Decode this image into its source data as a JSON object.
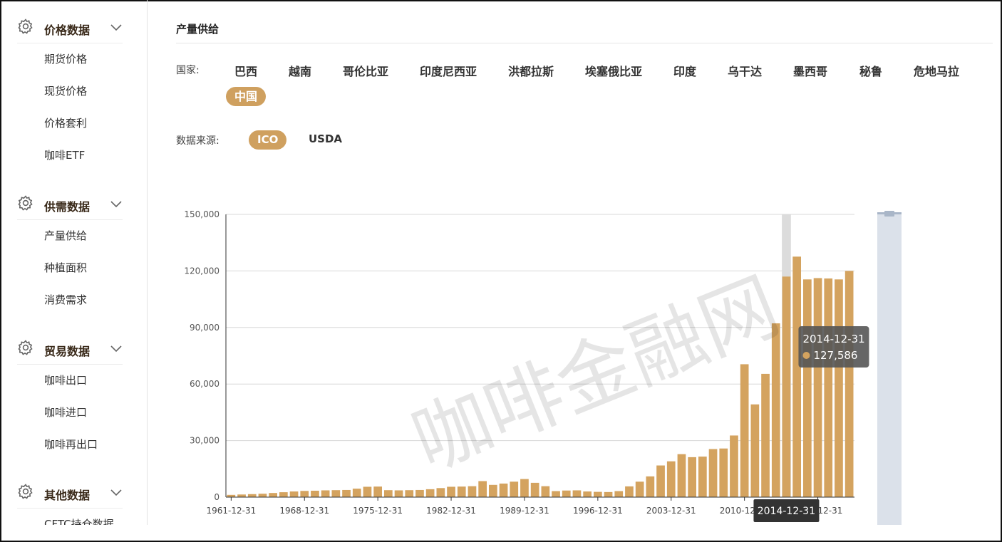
{
  "sidebar": {
    "groups": [
      {
        "title": "价格数据",
        "items": [
          "期货价格",
          "现货价格",
          "价格套利",
          "咖啡ETF"
        ]
      },
      {
        "title": "供需数据",
        "items": [
          "产量供给",
          "种植面积",
          "消费需求"
        ]
      },
      {
        "title": "贸易数据",
        "items": [
          "咖啡出口",
          "咖啡进口",
          "咖啡再出口"
        ]
      },
      {
        "title": "其他数据",
        "items": [
          "CFTC持仓数据"
        ]
      }
    ]
  },
  "main": {
    "title": "产量供给",
    "country_label": "国家:",
    "countries": [
      "巴西",
      "越南",
      "哥伦比亚",
      "印度尼西亚",
      "洪都拉斯",
      "埃塞俄比亚",
      "印度",
      "乌干达",
      "墨西哥",
      "秘鲁",
      "危地马拉",
      "中国"
    ],
    "selected_country": "中国",
    "source_label": "数据来源:",
    "sources": [
      "ICO",
      "USDA"
    ],
    "selected_source": "ICO"
  },
  "watermark": "咖啡金融网",
  "colors": {
    "bar": "#d4a35f",
    "accent": "#cfa05f",
    "highlight_column": "#dcdcdc",
    "tooltip_bg": "#555555",
    "axis_pointer_label": "#333333",
    "zoom_bar": "#dbe1ea"
  },
  "chart_data": {
    "type": "bar",
    "x_tick_labels": [
      "1961-12-31",
      "1968-12-31",
      "1975-12-31",
      "1982-12-31",
      "1989-12-31",
      "1996-12-31",
      "2003-12-31",
      "2010-12-31",
      "2017-12-31"
    ],
    "y_tick_labels": [
      "0",
      "30,000",
      "60,000",
      "90,000",
      "120,000",
      "150,000"
    ],
    "ylim": [
      0,
      150000
    ],
    "grid": true,
    "years": [
      1961,
      1962,
      1963,
      1964,
      1965,
      1966,
      1967,
      1968,
      1969,
      1970,
      1971,
      1972,
      1973,
      1974,
      1975,
      1976,
      1977,
      1978,
      1979,
      1980,
      1981,
      1982,
      1983,
      1984,
      1985,
      1986,
      1987,
      1988,
      1989,
      1990,
      1991,
      1992,
      1993,
      1994,
      1995,
      1996,
      1997,
      1998,
      1999,
      2000,
      2001,
      2002,
      2003,
      2004,
      2005,
      2006,
      2007,
      2008,
      2009,
      2010,
      2011,
      2012,
      2013,
      2014,
      2015,
      2016,
      2017,
      2018,
      2019
    ],
    "values": [
      1200,
      1400,
      1600,
      1800,
      2200,
      2600,
      3000,
      3300,
      3400,
      3600,
      3700,
      3800,
      4500,
      5500,
      5600,
      3700,
      3600,
      3700,
      3800,
      4200,
      4800,
      5500,
      5600,
      5800,
      8500,
      6500,
      7200,
      8200,
      9600,
      7600,
      5800,
      3200,
      3500,
      3600,
      3000,
      2800,
      2700,
      3200,
      5700,
      8200,
      11000,
      16800,
      19000,
      22800,
      21200,
      21500,
      25500,
      25800,
      32700,
      70500,
      49200,
      65400,
      92200,
      117000,
      127586,
      115500,
      116200,
      116000,
      115500,
      120000
    ],
    "tooltip": {
      "date": "2014-12-31",
      "value": "127,586"
    },
    "axis_pointer_label": "2014-12-31"
  }
}
